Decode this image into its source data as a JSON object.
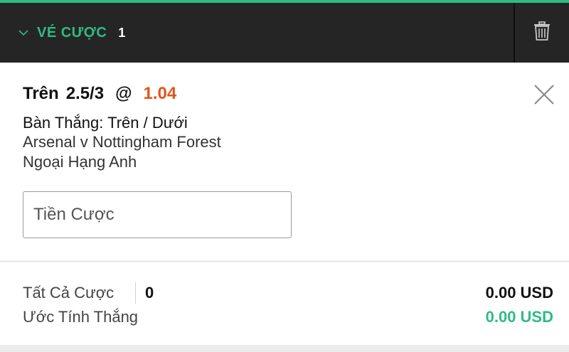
{
  "header": {
    "title": "VÉ CƯỢC",
    "count": "1",
    "accent_color": "#2fbb86",
    "icons": [
      "chevron-down-icon",
      "trash-icon"
    ]
  },
  "bet": {
    "selection": "Trên",
    "line": "2.5/3",
    "at": "@",
    "odds": "1.04",
    "odds_color": "#e0561c",
    "market": "Bàn Thắng: Trên / Dưới",
    "event": "Arsenal v Nottingham Forest",
    "league": "Ngoại Hạng Anh",
    "stake_placeholder": "Tiền Cược",
    "stake_value": ""
  },
  "summary": {
    "total_label": "Tất Cả Cược",
    "total_count": "0",
    "total_amount": "0.00 USD",
    "win_label": "Ước Tính Thắng",
    "win_amount": "0.00 USD"
  }
}
